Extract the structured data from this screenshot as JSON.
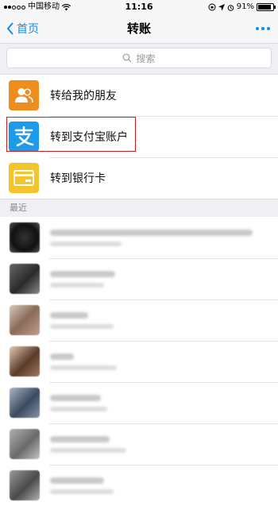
{
  "status_bar": {
    "carrier": "中国移动",
    "time": "11:16",
    "battery_percent": "91%",
    "battery_level": 0.91
  },
  "nav": {
    "back_label": "首页",
    "title": "转账"
  },
  "search": {
    "placeholder": "搜索"
  },
  "options": [
    {
      "label": "转给我的朋友",
      "icon": "friends-icon",
      "color": "#f08d1f"
    },
    {
      "label": "转到支付宝账户",
      "icon": "alipay-icon",
      "color": "#1d9bea"
    },
    {
      "label": "转到银行卡",
      "icon": "bank-card-icon",
      "color": "#f5c42b"
    }
  ],
  "recent": {
    "header": "最近"
  },
  "colors": {
    "accent": "#108ee9",
    "highlight_border": "#cc1f1f",
    "background": "#efeff4"
  }
}
